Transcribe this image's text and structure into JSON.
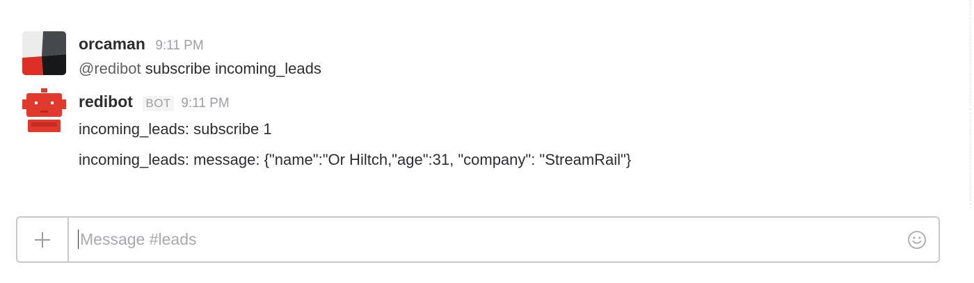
{
  "messages": [
    {
      "author": "orcaman",
      "time": "9:11 PM",
      "lines": [
        {
          "mention": "@redibot",
          "text": " subscribe incoming_leads"
        }
      ]
    },
    {
      "author": "redibot",
      "badge": "BOT",
      "time": "9:11 PM",
      "lines": [
        {
          "text": "incoming_leads: subscribe 1"
        },
        {
          "text": "incoming_leads: message: {\"name\":\"Or Hiltch,\"age\":31, \"company\": \"StreamRail\"}"
        }
      ]
    }
  ],
  "composer": {
    "placeholder": "Message #leads",
    "value": "",
    "add_icon": "plus-icon",
    "emoji_icon": "smiley-icon"
  },
  "colors": {
    "bot_red": "#e03a2e",
    "author_text": "#2c2d30",
    "muted_text": "#9e9ea6",
    "border": "#c8c8c8"
  }
}
